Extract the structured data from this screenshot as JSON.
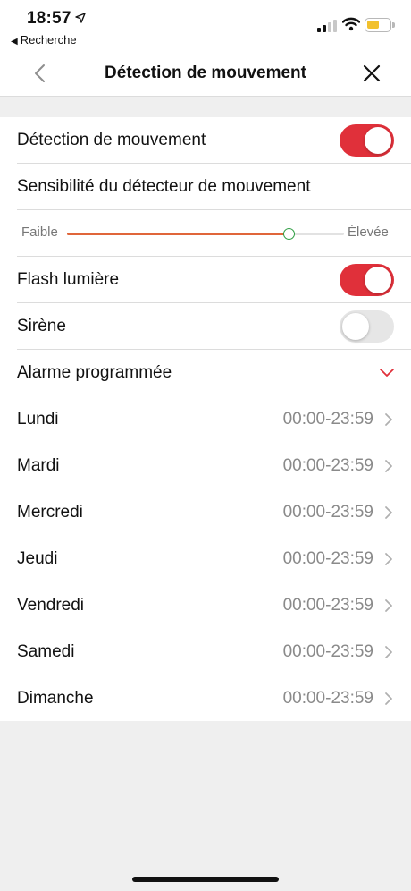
{
  "status_bar": {
    "time": "18:57",
    "back_app": "Recherche",
    "battery_color": "#f2c12e",
    "icons": [
      "location-arrow-icon",
      "signal-icon",
      "wifi-icon",
      "battery-icon"
    ]
  },
  "nav": {
    "title": "Détection de mouvement",
    "back_icon": "chevron-left-icon",
    "close_icon": "close-icon"
  },
  "settings": {
    "motion_detection": {
      "label": "Détection de mouvement",
      "enabled": true
    },
    "sensitivity": {
      "label": "Sensibilité du détecteur de mouvement",
      "low_label": "Faible",
      "high_label": "Élevée",
      "value": 0.8
    },
    "flash_light": {
      "label": "Flash lumière",
      "enabled": true
    },
    "siren": {
      "label": "Sirène",
      "enabled": false
    },
    "schedule": {
      "label": "Alarme programmée",
      "expanded": true
    }
  },
  "days": [
    {
      "name": "Lundi",
      "time": "00:00-23:59"
    },
    {
      "name": "Mardi",
      "time": "00:00-23:59"
    },
    {
      "name": "Mercredi",
      "time": "00:00-23:59"
    },
    {
      "name": "Jeudi",
      "time": "00:00-23:59"
    },
    {
      "name": "Vendredi",
      "time": "00:00-23:59"
    },
    {
      "name": "Samedi",
      "time": "00:00-23:59"
    },
    {
      "name": "Dimanche",
      "time": "00:00-23:59"
    }
  ],
  "colors": {
    "accent": "#e0303a",
    "slider_fill": "#e0663a",
    "slider_thumb_border": "#2f9e44"
  }
}
